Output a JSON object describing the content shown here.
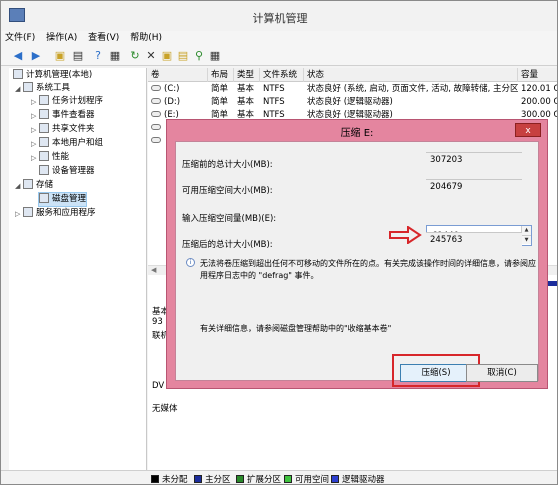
{
  "window": {
    "title": "计算机管理"
  },
  "menu": [
    "文件(F)",
    "操作(A)",
    "查看(V)",
    "帮助(H)"
  ],
  "tree": {
    "root": "计算机管理(本地)",
    "system_tools": "系统工具",
    "task_scheduler": "任务计划程序",
    "event_viewer": "事件查看器",
    "shared_folders": "共享文件夹",
    "local_users": "本地用户和组",
    "performance": "性能",
    "device_manager": "设备管理器",
    "storage": "存储",
    "disk_management": "磁盘管理",
    "services": "服务和应用程序"
  },
  "table": {
    "columns": [
      "卷",
      "布局",
      "类型",
      "文件系统",
      "状态",
      "容量"
    ],
    "rows": [
      {
        "vol": "(C:)",
        "layout": "简单",
        "type": "基本",
        "fs": "NTFS",
        "status": "状态良好 (系统, 启动, 页面文件, 活动, 故障转储, 主分区)",
        "cap": "120.01 G"
      },
      {
        "vol": "(D:)",
        "layout": "简单",
        "type": "基本",
        "fs": "NTFS",
        "status": "状态良好 (逻辑驱动器)",
        "cap": "200.00 G"
      },
      {
        "vol": "(E:)",
        "layout": "简单",
        "type": "基本",
        "fs": "NTFS",
        "status": "状态良好 (逻辑驱动器)",
        "cap": "300.00 G"
      },
      {
        "vol": "",
        "layout": "",
        "type": "",
        "fs": "",
        "status": "",
        "cap": ""
      },
      {
        "vol": "",
        "layout": "",
        "type": "",
        "fs": "",
        "status": "",
        "cap": ""
      }
    ]
  },
  "lower": {
    "disk0_a": "基本",
    "disk0_b": "93",
    "disk0_c": "联机",
    "cd_label": "DV",
    "cd_status": "无媒体"
  },
  "legend": [
    "未分配",
    "主分区",
    "扩展分区",
    "可用空间",
    "逻辑驱动器"
  ],
  "colors": {
    "unallocated": "#000000",
    "primary": "#1c2d9c",
    "extended": "#2a8a2a",
    "free": "#3fc33f",
    "logical": "#2d3fcf"
  },
  "dialog": {
    "title": "压缩 E:",
    "close_label": "x",
    "total_before_label": "压缩前的总计大小(MB):",
    "total_before_value": "307203",
    "available_label": "可用压缩空间大小(MB):",
    "available_value": "204679",
    "enter_label": "输入压缩空间量(MB)(E):",
    "enter_value": "61440",
    "total_after_label": "压缩后的总计大小(MB):",
    "total_after_value": "245763",
    "note": "无法将卷压缩到超出任何不可移动的文件所在的点。有关完成该操作时间的详细信息，请参阅应用程序日志中的 \"defrag\" 事件。",
    "help": "有关详细信息，请参阅磁盘管理帮助中的\"收缩基本卷\"",
    "shrink_button": "压缩(S)",
    "cancel_button": "取消(C)"
  }
}
